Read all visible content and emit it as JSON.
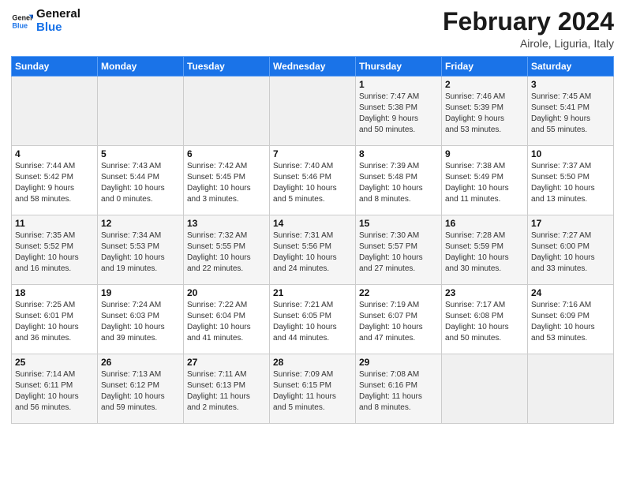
{
  "header": {
    "logo_general": "General",
    "logo_blue": "Blue",
    "title": "February 2024",
    "subtitle": "Airole, Liguria, Italy"
  },
  "weekdays": [
    "Sunday",
    "Monday",
    "Tuesday",
    "Wednesday",
    "Thursday",
    "Friday",
    "Saturday"
  ],
  "weeks": [
    [
      {
        "day": "",
        "info": "",
        "empty": true
      },
      {
        "day": "",
        "info": "",
        "empty": true
      },
      {
        "day": "",
        "info": "",
        "empty": true
      },
      {
        "day": "",
        "info": "",
        "empty": true
      },
      {
        "day": "1",
        "info": "Sunrise: 7:47 AM\nSunset: 5:38 PM\nDaylight: 9 hours\nand 50 minutes."
      },
      {
        "day": "2",
        "info": "Sunrise: 7:46 AM\nSunset: 5:39 PM\nDaylight: 9 hours\nand 53 minutes."
      },
      {
        "day": "3",
        "info": "Sunrise: 7:45 AM\nSunset: 5:41 PM\nDaylight: 9 hours\nand 55 minutes."
      }
    ],
    [
      {
        "day": "4",
        "info": "Sunrise: 7:44 AM\nSunset: 5:42 PM\nDaylight: 9 hours\nand 58 minutes."
      },
      {
        "day": "5",
        "info": "Sunrise: 7:43 AM\nSunset: 5:44 PM\nDaylight: 10 hours\nand 0 minutes."
      },
      {
        "day": "6",
        "info": "Sunrise: 7:42 AM\nSunset: 5:45 PM\nDaylight: 10 hours\nand 3 minutes."
      },
      {
        "day": "7",
        "info": "Sunrise: 7:40 AM\nSunset: 5:46 PM\nDaylight: 10 hours\nand 5 minutes."
      },
      {
        "day": "8",
        "info": "Sunrise: 7:39 AM\nSunset: 5:48 PM\nDaylight: 10 hours\nand 8 minutes."
      },
      {
        "day": "9",
        "info": "Sunrise: 7:38 AM\nSunset: 5:49 PM\nDaylight: 10 hours\nand 11 minutes."
      },
      {
        "day": "10",
        "info": "Sunrise: 7:37 AM\nSunset: 5:50 PM\nDaylight: 10 hours\nand 13 minutes."
      }
    ],
    [
      {
        "day": "11",
        "info": "Sunrise: 7:35 AM\nSunset: 5:52 PM\nDaylight: 10 hours\nand 16 minutes."
      },
      {
        "day": "12",
        "info": "Sunrise: 7:34 AM\nSunset: 5:53 PM\nDaylight: 10 hours\nand 19 minutes."
      },
      {
        "day": "13",
        "info": "Sunrise: 7:32 AM\nSunset: 5:55 PM\nDaylight: 10 hours\nand 22 minutes."
      },
      {
        "day": "14",
        "info": "Sunrise: 7:31 AM\nSunset: 5:56 PM\nDaylight: 10 hours\nand 24 minutes."
      },
      {
        "day": "15",
        "info": "Sunrise: 7:30 AM\nSunset: 5:57 PM\nDaylight: 10 hours\nand 27 minutes."
      },
      {
        "day": "16",
        "info": "Sunrise: 7:28 AM\nSunset: 5:59 PM\nDaylight: 10 hours\nand 30 minutes."
      },
      {
        "day": "17",
        "info": "Sunrise: 7:27 AM\nSunset: 6:00 PM\nDaylight: 10 hours\nand 33 minutes."
      }
    ],
    [
      {
        "day": "18",
        "info": "Sunrise: 7:25 AM\nSunset: 6:01 PM\nDaylight: 10 hours\nand 36 minutes."
      },
      {
        "day": "19",
        "info": "Sunrise: 7:24 AM\nSunset: 6:03 PM\nDaylight: 10 hours\nand 39 minutes."
      },
      {
        "day": "20",
        "info": "Sunrise: 7:22 AM\nSunset: 6:04 PM\nDaylight: 10 hours\nand 41 minutes."
      },
      {
        "day": "21",
        "info": "Sunrise: 7:21 AM\nSunset: 6:05 PM\nDaylight: 10 hours\nand 44 minutes."
      },
      {
        "day": "22",
        "info": "Sunrise: 7:19 AM\nSunset: 6:07 PM\nDaylight: 10 hours\nand 47 minutes."
      },
      {
        "day": "23",
        "info": "Sunrise: 7:17 AM\nSunset: 6:08 PM\nDaylight: 10 hours\nand 50 minutes."
      },
      {
        "day": "24",
        "info": "Sunrise: 7:16 AM\nSunset: 6:09 PM\nDaylight: 10 hours\nand 53 minutes."
      }
    ],
    [
      {
        "day": "25",
        "info": "Sunrise: 7:14 AM\nSunset: 6:11 PM\nDaylight: 10 hours\nand 56 minutes."
      },
      {
        "day": "26",
        "info": "Sunrise: 7:13 AM\nSunset: 6:12 PM\nDaylight: 10 hours\nand 59 minutes."
      },
      {
        "day": "27",
        "info": "Sunrise: 7:11 AM\nSunset: 6:13 PM\nDaylight: 11 hours\nand 2 minutes."
      },
      {
        "day": "28",
        "info": "Sunrise: 7:09 AM\nSunset: 6:15 PM\nDaylight: 11 hours\nand 5 minutes."
      },
      {
        "day": "29",
        "info": "Sunrise: 7:08 AM\nSunset: 6:16 PM\nDaylight: 11 hours\nand 8 minutes."
      },
      {
        "day": "",
        "info": "",
        "empty": true
      },
      {
        "day": "",
        "info": "",
        "empty": true
      }
    ]
  ]
}
